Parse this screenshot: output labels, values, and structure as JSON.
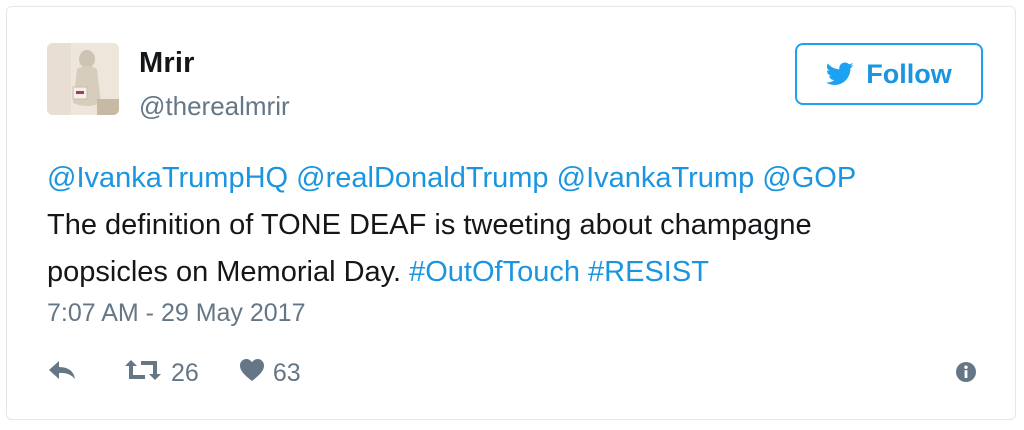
{
  "user": {
    "name": "Mrir",
    "handle": "@therealmrir"
  },
  "follow_button": {
    "label": "Follow",
    "icon": "twitter-bird-icon"
  },
  "tweet": {
    "line1_mentions": [
      "@IvankaTrumpHQ",
      "@realDonaldTrump",
      "@IvankaTrump",
      "@GOP"
    ],
    "line2": "The definition of TONE DEAF is tweeting about champagne",
    "line3_text": "popsicles on Memorial Day.",
    "hashtags": [
      "#OutOfTouch",
      "#RESIST"
    ],
    "timestamp": "7:07 AM - 29 May 2017"
  },
  "actions": {
    "reply_icon": "reply-icon",
    "retweet_icon": "retweet-icon",
    "retweet_count": "26",
    "like_icon": "heart-icon",
    "like_count": "63",
    "info_icon": "info-icon"
  },
  "colors": {
    "link": "#1b95e0",
    "text": "#14171a",
    "secondary": "#657786",
    "border": "#e1e8ed"
  }
}
